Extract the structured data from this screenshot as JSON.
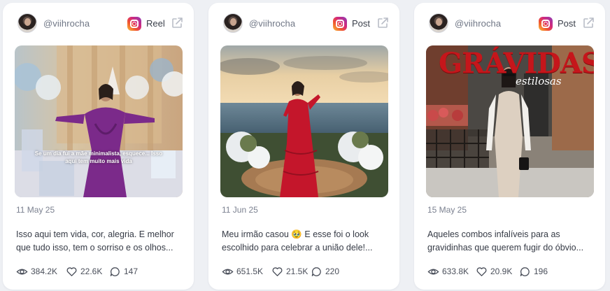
{
  "cards": [
    {
      "username": "@viihrocha",
      "type": "Reel",
      "date": "11 May 25",
      "caption": "Isso aqui tem vida, cor, alegria. E melhor que tudo isso, tem o sorriso e os olhos...",
      "overlay_text": "Se um dia fui a mãe minimalista, esquece... Isso aqui tem muito mais vida",
      "views": "384.2K",
      "likes": "22.6K",
      "comments": "147"
    },
    {
      "username": "@viihrocha",
      "type": "Post",
      "date": "11 Jun 25",
      "caption": "Meu irmão casou 🥹 E esse foi o look escolhido para celebrar a união dele!...",
      "views": "651.5K",
      "likes": "21.5K",
      "comments": "220"
    },
    {
      "username": "@viihrocha",
      "type": "Post",
      "date": "15 May 25",
      "caption": "Aqueles combos infalíveis para as gravidinhas que querem fugir do óbvio...",
      "magazine_title": "GRÁVIDAS",
      "magazine_subtitle": "estilosas",
      "views": "633.8K",
      "likes": "20.9K",
      "comments": "196"
    }
  ],
  "icons": {
    "instagram": "instagram-icon",
    "external": "external-link-icon",
    "views": "eye-icon",
    "likes": "heart-icon",
    "comments": "comment-icon"
  },
  "colors": {
    "background": "#eef0f4",
    "card": "#ffffff",
    "muted_text": "#7b8190",
    "body_text": "#353a45"
  }
}
